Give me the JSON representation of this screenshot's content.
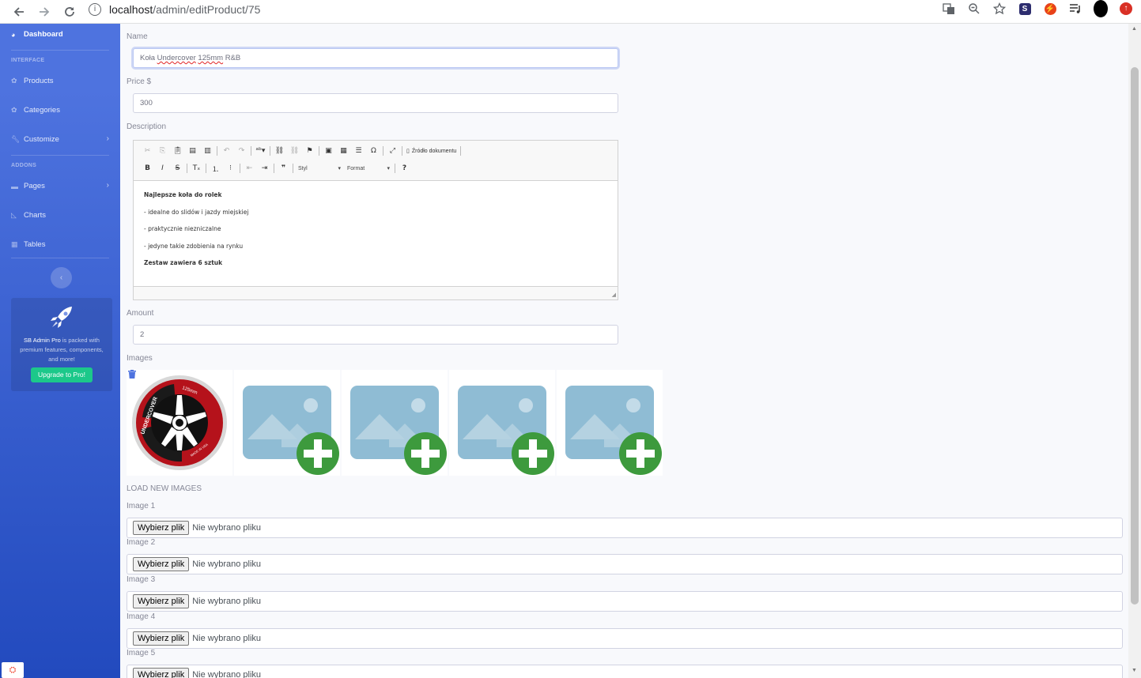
{
  "browser": {
    "url_host": "localhost",
    "url_path": "/admin/editProduct/75"
  },
  "sidebar": {
    "dashboard": "Dashboard",
    "heading_interface": "INTERFACE",
    "heading_addons": "ADDONS",
    "items": [
      {
        "label": "Products",
        "icon": "cog-icon"
      },
      {
        "label": "Categories",
        "icon": "cog-icon"
      },
      {
        "label": "Customize",
        "icon": "wrench-icon"
      },
      {
        "label": "Pages",
        "icon": "folder-icon"
      },
      {
        "label": "Charts",
        "icon": "chart-area-icon"
      },
      {
        "label": "Tables",
        "icon": "table-icon"
      }
    ],
    "promo_bold": "SB Admin Pro",
    "promo_text": " is packed with premium features, components, and more!",
    "promo_button": "Upgrade to Pro!"
  },
  "form": {
    "name_label": "Name",
    "name_prefix": "Koła ",
    "name_spell": "Undercover",
    "name_mid": " ",
    "name_spell2": "125mm",
    "name_suffix": " R&B",
    "price_label": "Price $",
    "price_value": "300",
    "description_label": "Description",
    "amount_label": "Amount",
    "amount_value": "2",
    "images_label": "Images",
    "load_new_images": "LOAD NEW IMAGES",
    "file_inputs": [
      {
        "label": "Image 1",
        "button": "Wybierz plik",
        "status": "Nie wybrano pliku"
      },
      {
        "label": "Image 2",
        "button": "Wybierz plik",
        "status": "Nie wybrano pliku"
      },
      {
        "label": "Image 3",
        "button": "Wybierz plik",
        "status": "Nie wybrano pliku"
      },
      {
        "label": "Image 4",
        "button": "Wybierz plik",
        "status": "Nie wybrano pliku"
      },
      {
        "label": "Image 5",
        "button": "Wybierz plik",
        "status": "Nie wybrano pliku"
      }
    ]
  },
  "editor": {
    "source_label": "Źródło dokumentu",
    "style_combo": "Styl",
    "format_combo": "Format",
    "content": [
      {
        "text": "Najlepsze koła do rolek",
        "bold": true
      },
      {
        "text": "- idealne do slidów i jazdy miejskiej",
        "bold": false
      },
      {
        "text": "- praktycznie niezniczalne",
        "bold": false
      },
      {
        "text": "- jedyne takie zdobienia na rynku",
        "bold": false
      },
      {
        "text": "Zestaw zawiera 6 sztuk",
        "bold": true
      }
    ]
  },
  "wheel": {
    "brand": "UNDERCOVER",
    "size": "125mm",
    "origin": "MADE IN USA"
  },
  "colors": {
    "sidebar_top": "#4e73df",
    "sidebar_bottom": "#224abe",
    "upgrade_button": "#1cc88a",
    "add_image_green": "#3d9a3d",
    "placeholder_blue": "#8fbcd4"
  }
}
